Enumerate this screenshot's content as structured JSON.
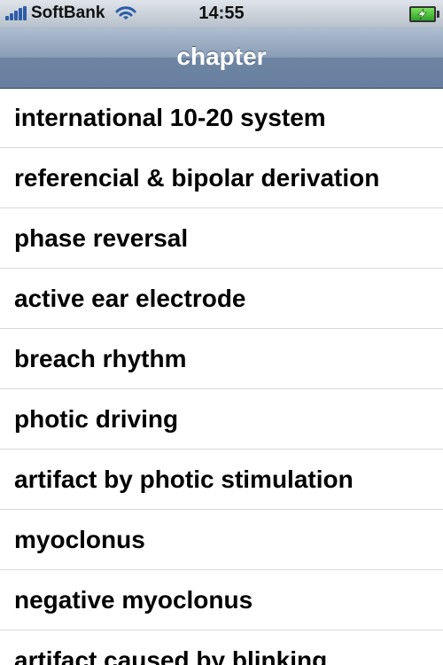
{
  "status_bar": {
    "carrier": "SoftBank",
    "time": "14:55",
    "signal_icon": "signal-bars-icon",
    "wifi_icon": "wifi-icon",
    "battery_icon": "battery-charging-icon",
    "battery_color": "#2ea12a"
  },
  "nav_bar": {
    "title": "chapter"
  },
  "chapters": [
    {
      "label": "international 10-20 system"
    },
    {
      "label": "referencial & bipolar derivation"
    },
    {
      "label": "phase reversal"
    },
    {
      "label": "active ear electrode"
    },
    {
      "label": "breach rhythm"
    },
    {
      "label": "photic driving"
    },
    {
      "label": "artifact by photic stimulation"
    },
    {
      "label": "myoclonus"
    },
    {
      "label": "negative myoclonus"
    },
    {
      "label": "artifact caused by blinking"
    }
  ]
}
